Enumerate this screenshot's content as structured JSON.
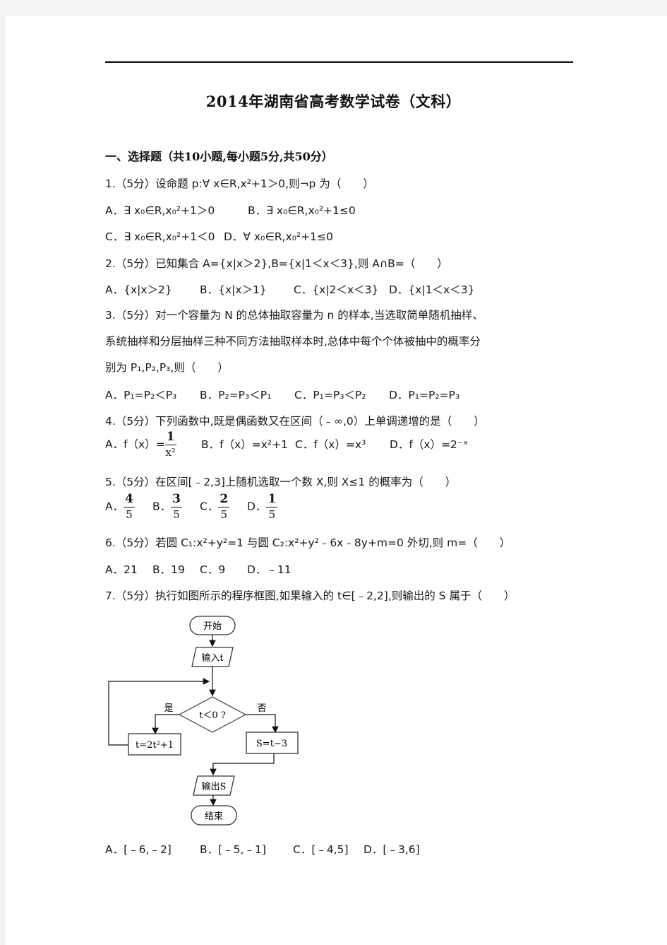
{
  "document": {
    "title": "2014年湖南省高考数学试卷（文科）",
    "section_heading": "一、选择题（共10小题,每小题5分,共50分）"
  },
  "questions": [
    {
      "number": "1",
      "stem": "1.（5分）设命题 p:∀ x∈R,x²+1＞0,则¬p 为（　　）",
      "options": [
        "A．∃ x₀∈R,x₀²+1＞0",
        "B．∃ x₀∈R,x₀²+1≤0",
        "C．∃ x₀∈R,x₀²+1＜0",
        "D．∀ x₀∈R,x₀²+1≤0"
      ]
    },
    {
      "number": "2",
      "stem": "2.（5分）已知集合 A={x|x＞2},B={x|1＜x＜3},则 A∩B=（　　）",
      "options": [
        "A．{x|x＞2}",
        "B．{x|x＞1}",
        "C．{x|2＜x＜3}",
        "D．{x|1＜x＜3}"
      ]
    },
    {
      "number": "3",
      "stem_lines": [
        "3.（5分）对一个容量为 N 的总体抽取容量为 n 的样本,当选取简单随机抽样、",
        "系统抽样和分层抽样三种不同方法抽取样本时,总体中每个个体被抽中的概率分",
        "别为 P₁,P₂,P₃,则（　　）"
      ],
      "options": [
        "A．P₁=P₂＜P₃",
        "B．P₂=P₃＜P₁",
        "C．P₁=P₃＜P₂",
        "D．P₁=P₂=P₃"
      ]
    },
    {
      "number": "4",
      "stem": "4.（5分）下列函数中,既是偶函数又在区间（﹣∞,0）上单调递增的是（　　）",
      "options": [
        {
          "prefix": "A．f（x）=",
          "frac_num": "1",
          "frac_den": "x²"
        },
        "B．f（x）=x²+1",
        "C．f（x）=x³",
        "D．f（x）=2⁻ˣ"
      ]
    },
    {
      "number": "5",
      "stem": "5.（5分）在区间[﹣2,3]上随机选取一个数 X,则 X≤1 的概率为（　　）",
      "options": [
        {
          "label": "A．",
          "num": "4",
          "den": "5"
        },
        {
          "label": "B．",
          "num": "3",
          "den": "5"
        },
        {
          "label": "C．",
          "num": "2",
          "den": "5"
        },
        {
          "label": "D．",
          "num": "1",
          "den": "5"
        }
      ]
    },
    {
      "number": "6",
      "stem": "6.（5分）若圆 C₁:x²+y²=1 与圆 C₂:x²+y²﹣6x﹣8y+m=0 外切,则 m=（　　）",
      "options": [
        "A．21",
        "B．19",
        "C．9",
        "D．﹣11"
      ]
    },
    {
      "number": "7",
      "stem": "7.（5分）执行如图所示的程序框图,如果输入的 t∈[﹣2,2],则输出的 S 属于（　　）",
      "flowchart": {
        "start": "开始",
        "input": "输入t",
        "condition": "t＜0 ?",
        "yes_label": "是",
        "no_label": "否",
        "yes_step": "t=2t²+1",
        "no_step": "S=t−3",
        "output": "输出S",
        "end": "结束"
      },
      "options": [
        "A．[﹣6,﹣2]",
        "B．[﹣5,﹣1]",
        "C．[﹣4,5]",
        "D．[﹣3,6]"
      ]
    }
  ]
}
